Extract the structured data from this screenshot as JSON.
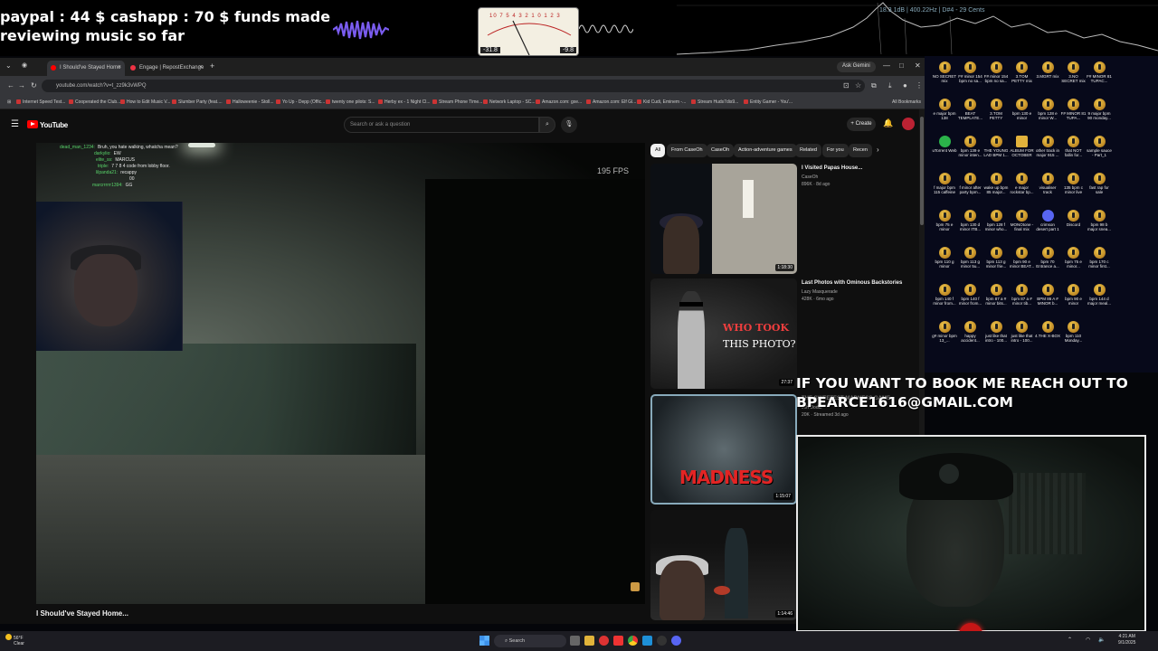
{
  "overlay": {
    "donation_line1": "paypal : 44 $  cashapp : 70 $ funds made",
    "donation_line2": "reviewing music so far",
    "vu_scale": "10 7 5 4 3 2 1 0 1 2 3",
    "vu_left_db": "-31.8",
    "vu_right_db": "-9.8",
    "spectrum_label": "18.3 1dB | 400.22Hz | D#4 - 29 Cents"
  },
  "browser": {
    "tabs": [
      {
        "title": "I Should've Stayed Home",
        "active": true
      },
      {
        "title": "Engage | RepostExchange",
        "active": false
      }
    ],
    "gemini_label": "Ask Gemini",
    "url": "youtube.com/watch?v=t_zz9k3vWPQ",
    "bookmarks": [
      "Internet Speed Test...",
      "Cooperated the Club...",
      "How to Edit Music V...",
      "Slumber Party (feat....",
      "Halloweenie - Stoll...",
      "Yo Up - Depp (Offic...",
      "twenty one pilots: S...",
      "Herby ex - 1 Night Cl...",
      "Stream Phone Time...",
      "Network Laptop - SC...",
      "Amazon.com: gxe...",
      "Amazon.com: Elf Gl...",
      "Kid Cudi, Eminem -...",
      "Stream Huds7dis9...",
      "Entity Gamer - You'..."
    ],
    "all_bookmarks": "All Bookmarks"
  },
  "youtube": {
    "logo_text": "YouTube",
    "search_placeholder": "Search or ask a question",
    "create_label": "Create",
    "fps": "195  FPS",
    "video_title": "I Should've Stayed Home...",
    "chat": [
      {
        "user": "dead_man_1234:",
        "msg": "Bruh, you hate walking, whatcha mean?"
      },
      {
        "user": "darkylio:",
        "msg": "EW"
      },
      {
        "user": "elite_ss:",
        "msg": "MARCUS"
      },
      {
        "user": "triple:",
        "msg": "7 7 8 4 code from lobby floor."
      },
      {
        "user": "lilpanda21:",
        "msg": "recappy"
      },
      {
        "user": "",
        "msg": "00"
      },
      {
        "user": "marcrrrrrr1394:",
        "msg": "GG"
      }
    ],
    "chips": [
      "All",
      "From CaseOh",
      "CaseOh",
      "Action-adventure games",
      "Related",
      "For you",
      "Recen"
    ],
    "recommendations": [
      {
        "title": "I Visited Papas House...",
        "channel": "CaseOh",
        "meta": "896K  ·  8d ago",
        "duration": "1:18:30"
      },
      {
        "title": "Last Photos with Ominous Backstories",
        "channel": "Lazy Masquerade",
        "meta": "428K  ·  6mo ago",
        "duration": "27:37"
      },
      {
        "title": "THE SWEETEST MADNESS GAME",
        "channel": "Joh Dodal",
        "meta": "20K  ·  Streamed 3d ago",
        "duration": "1:15:07"
      },
      {
        "title": "",
        "channel": "",
        "meta": "",
        "duration": "1:14:46"
      }
    ],
    "thumb_text": {
      "who_took": "WHO TOOK",
      "this_photo": "THIS PHOTO?",
      "madness": "MADNESS"
    }
  },
  "desktop": {
    "icons": [
      "NO SECRET mix",
      "F# minor 154 bpm no sa...",
      "F# minor 154 bpm no sa...",
      "3.TOM PETTY mix",
      "3.MGRT mix",
      "3.NO SECRET mix",
      "F# MINOR 81 TUPAC...",
      "e major bpm 138",
      "BEAT TEMPLATE...",
      "3.TOM PETTY",
      "bpm 130 e minor",
      "bpm 128 e minor W...",
      "F# MINOR 81 TUPA...",
      "9 major bpm 90 monday...",
      "uTorrent Web",
      "bpm 139 e minor inten...",
      "THE YOUNG LAD BPM 1...",
      "ALBUM FOR OCTOBER",
      "other track in major 915 ...",
      "that NOT fallin for...",
      "sample sauce - Part_1",
      "f major bpm 115 caffeine",
      "f minor after party bpm...",
      "wake up bpm 85 major...",
      "e major rockstar bp...",
      "visualiser track",
      "135 bpm c minor live",
      "fast rap for sale",
      "bpm 75 e minor",
      "bpm 130 d minor ITB...",
      "bpm 128 f minor who...",
      "MONOtone - final mix",
      "crimson desert part 1",
      "Discord",
      "bpm 98 b major snea...",
      "bpm 110 g minor",
      "bpm 113 g minor 5u...",
      "bpm 113 g minor frie...",
      "bpm 90 e minor BEAT...",
      "bpm 70 Entrance a...",
      "bpm 75 e minor...",
      "bpm 170 c minor first...",
      "bpm 140 f minor from...",
      "bpm 140 f minor from...",
      "bpm 87 a # minor bits...",
      "bpm 87 a # minor tib...",
      "BPM 86 A # MINOR b...",
      "bpm 90 e minor",
      "bpm 144 d major meal...",
      "g# minor bpm 13_...",
      "happy accident...",
      "just like that intro - 100...",
      "just like that intro - 100...",
      "4.THE X-BOX",
      "bpm 110 Monday..."
    ]
  },
  "booking": {
    "line1": "IF YOU WANT TO BOOK ME REACH OUT TO",
    "line2": "BPEARCE1616@GMAIL.COM"
  },
  "taskbar": {
    "weather_temp": "56°F",
    "weather_desc": "Clear",
    "search_label": "Search",
    "time": "4:21 AM",
    "date": "9/1/2025"
  }
}
